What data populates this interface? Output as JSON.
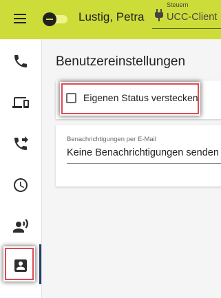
{
  "header": {
    "user_name": "Lustig, Petra",
    "steuern_label": "Steuern",
    "steuern_value": "UCC-Client",
    "menu_icon": "menu-icon",
    "status_toggle_state": "off",
    "plug_icon": "plug-icon"
  },
  "sidebar": {
    "items": [
      {
        "icon": "phone-icon"
      },
      {
        "icon": "devices-icon"
      },
      {
        "icon": "phone-forward-icon"
      },
      {
        "icon": "clock-icon"
      },
      {
        "icon": "record-voice-icon"
      },
      {
        "icon": "contact-card-icon",
        "active": true
      }
    ]
  },
  "main": {
    "title": "Benutzereinstellungen",
    "hide_status": {
      "label": "Eigenen Status verstecken",
      "checked": false
    },
    "email_notifications": {
      "label": "Benachrichtigungen per E-Mail",
      "value": "Keine Benachrichtigungen senden"
    }
  },
  "colors": {
    "topbar": "#cddc39",
    "highlight": "#e04a55",
    "active_indicator": "#233f6b",
    "icon": "#2e2e2e"
  }
}
